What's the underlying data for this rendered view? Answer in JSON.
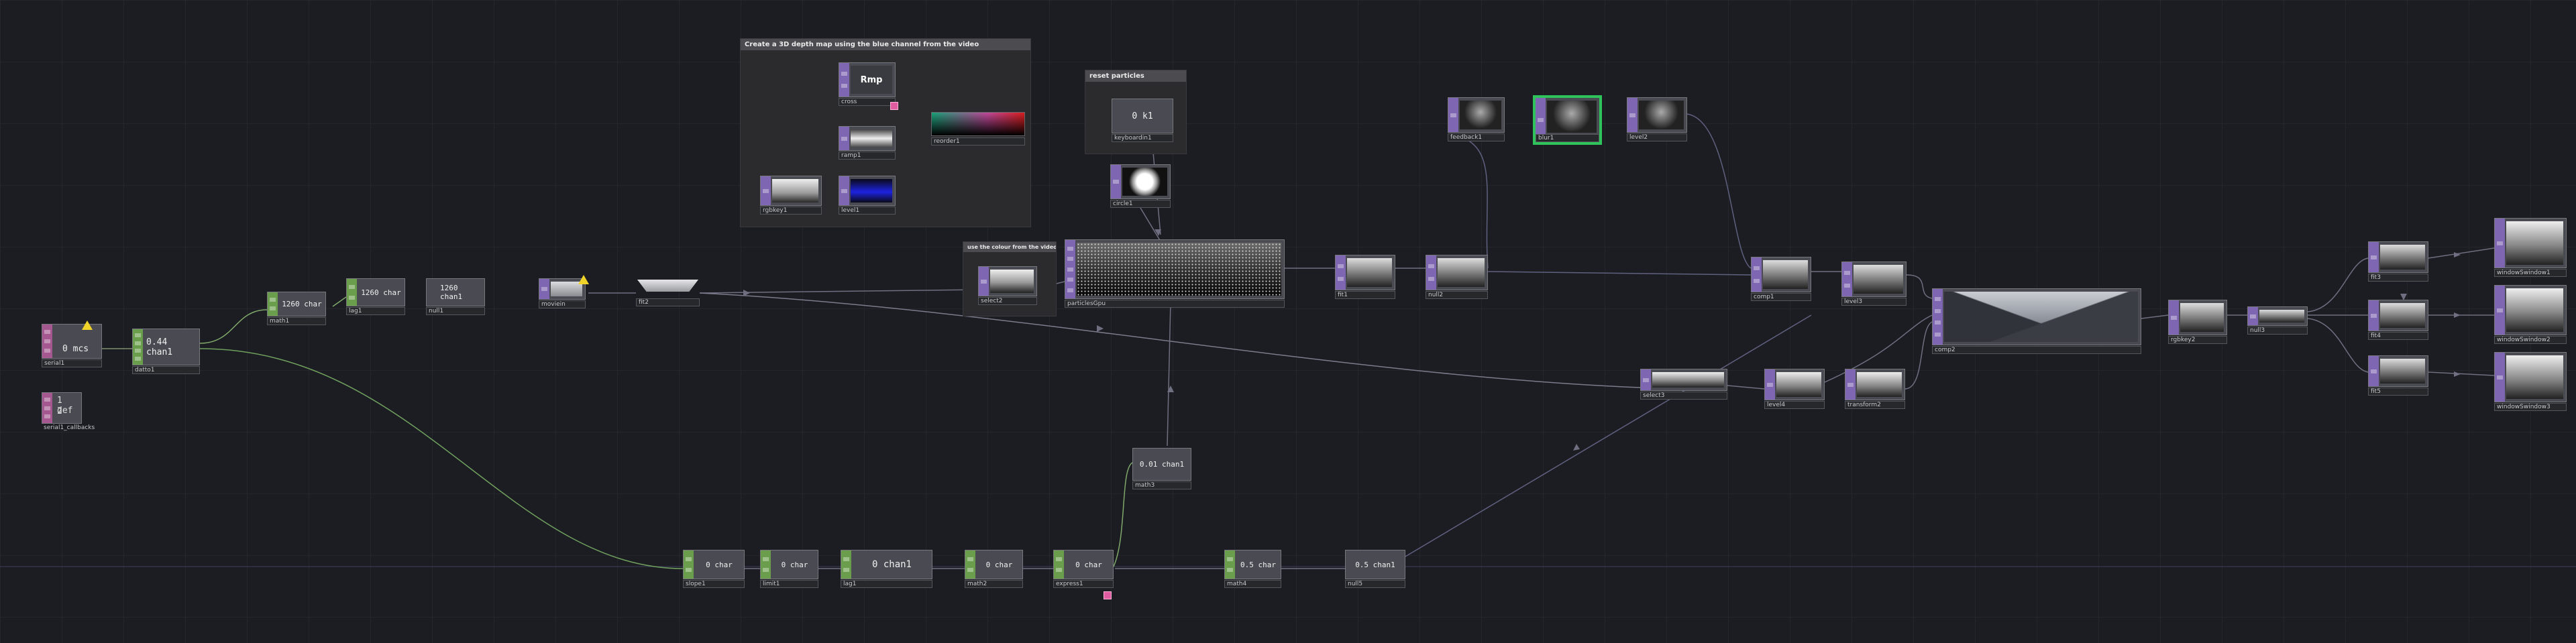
{
  "app": "TouchDesigner network editor",
  "colors": {
    "top": "#7f66b3",
    "chop": "#6a9e4c",
    "dat": "#a4588f",
    "selected": "#2fc35c",
    "warning": "#f1d42a"
  },
  "annotations": {
    "depth": "Create a 3D depth map using the blue channel from the video",
    "reset": "reset particles",
    "colour": "use the colour from the video"
  },
  "nodes": {
    "serial1": {
      "label": "serial1",
      "value": "0 mcs"
    },
    "serial1_callbacks": {
      "label": "serial1_callbacks",
      "line1": "1 def",
      "line2": "2"
    },
    "datto1": {
      "label": "datto1",
      "value": "0.44 chan1"
    },
    "math1": {
      "label": "math1",
      "value": "1260 char"
    },
    "lag1": {
      "label": "lag1",
      "value": "1260 char"
    },
    "null1": {
      "label": "null1",
      "value": "1260 chan1"
    },
    "moviein": {
      "label": "moviein"
    },
    "fit2": {
      "label": "fit2"
    },
    "rgbkey1": {
      "label": "rgbkey1"
    },
    "cross": {
      "label": "cross"
    },
    "ramp1": {
      "label": "ramp1"
    },
    "level1": {
      "label": "level1"
    },
    "reorder1": {
      "label": "reorder1"
    },
    "ramp1_text": "Rmp",
    "keyboardin1": {
      "label": "keyboardin1",
      "value": "0 k1"
    },
    "circle1": {
      "label": "circle1"
    },
    "select2": {
      "label": "select2"
    },
    "particlesGpu": {
      "label": "particlesGpu"
    },
    "fit1": {
      "label": "fit1"
    },
    "null2": {
      "label": "null2"
    },
    "feedback1": {
      "label": "feedback1"
    },
    "blur1": {
      "label": "blur1"
    },
    "level2": {
      "label": "level2"
    },
    "comp1": {
      "label": "comp1"
    },
    "level3": {
      "label": "level3"
    },
    "comp2": {
      "label": "comp2"
    },
    "select3": {
      "label": "select3"
    },
    "level4": {
      "label": "level4"
    },
    "transform2": {
      "label": "transform2"
    },
    "rgbkey2": {
      "label": "rgbkey2"
    },
    "null3": {
      "label": "null3"
    },
    "fit3": {
      "label": "fit3"
    },
    "fit4": {
      "label": "fit4"
    },
    "fit5": {
      "label": "fit5"
    },
    "window1": {
      "label": "windowSwindow1"
    },
    "window2": {
      "label": "windowSwindow2"
    },
    "window3": {
      "label": "windowSwindow3"
    },
    "slope1": {
      "label": "slope1",
      "value": "0 char"
    },
    "limit1": {
      "label": "limit1",
      "value": "0 char"
    },
    "lag2": {
      "label": "lag1",
      "value": "0 chan1"
    },
    "math2": {
      "label": "math2",
      "value": "0 char"
    },
    "express": {
      "label": "express1",
      "value": "0 char"
    },
    "math3": {
      "label": "math3",
      "value": "0.01 chan1"
    },
    "math4": {
      "label": "math4",
      "value": "0.5 char"
    },
    "null5": {
      "label": "null5",
      "value": "0.5 chan1"
    }
  }
}
